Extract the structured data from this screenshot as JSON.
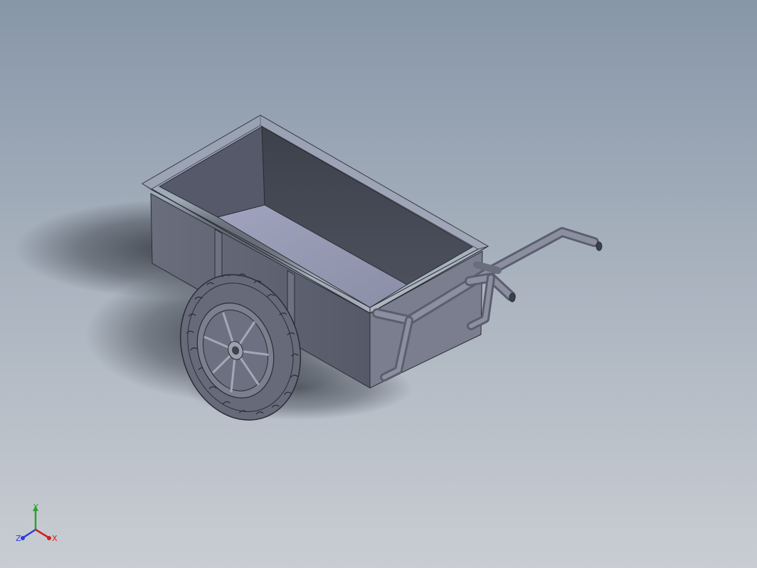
{
  "scene": {
    "model": "cart",
    "background_top": "#8796a8",
    "background_bottom": "#c9cdd3",
    "part_color": "#5f6372",
    "shadow_color": "#3a3f48"
  },
  "triad": {
    "x_label": "X",
    "y_label": "Y",
    "z_label": "Z",
    "x_color": "#d0201f",
    "y_color": "#2ea02e",
    "z_color": "#2b3fd6"
  }
}
